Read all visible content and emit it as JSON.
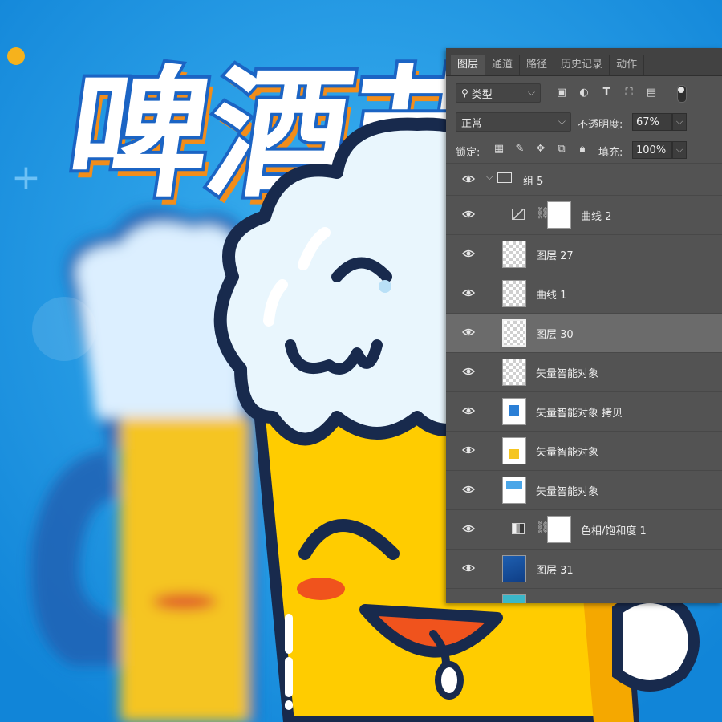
{
  "artwork": {
    "title_text": "啤酒节",
    "background_color": "#1a9be8",
    "beer_yellow": "#ffcc00",
    "outline_color": "#182a4d",
    "foam_color": "#e9f6fd"
  },
  "panel": {
    "tabs": [
      "图层",
      "通道",
      "路径",
      "历史记录",
      "动作"
    ],
    "active_tab": "图层",
    "filter": {
      "label": "类型"
    },
    "blend_mode": "正常",
    "opacity_label": "不透明度:",
    "opacity_value": "67%",
    "lock_label": "锁定:",
    "fill_label": "填充:",
    "fill_value": "100%",
    "group": {
      "name": "组 5"
    },
    "layers": [
      {
        "name": "曲线 2",
        "type": "adjustment-curves"
      },
      {
        "name": "图层 27",
        "type": "pixel"
      },
      {
        "name": "曲线 1",
        "type": "pixel"
      },
      {
        "name": "图层 30",
        "type": "pixel",
        "selected": true
      },
      {
        "name": "矢量智能对象",
        "type": "smart-object"
      },
      {
        "name": "矢量智能对象 拷贝",
        "type": "smart-object"
      },
      {
        "name": "矢量智能对象",
        "type": "smart-object"
      },
      {
        "name": "矢量智能对象",
        "type": "smart-object"
      },
      {
        "name": "色相/饱和度 1",
        "type": "adjustment-hue"
      },
      {
        "name": "图层 31",
        "type": "pixel"
      }
    ]
  }
}
